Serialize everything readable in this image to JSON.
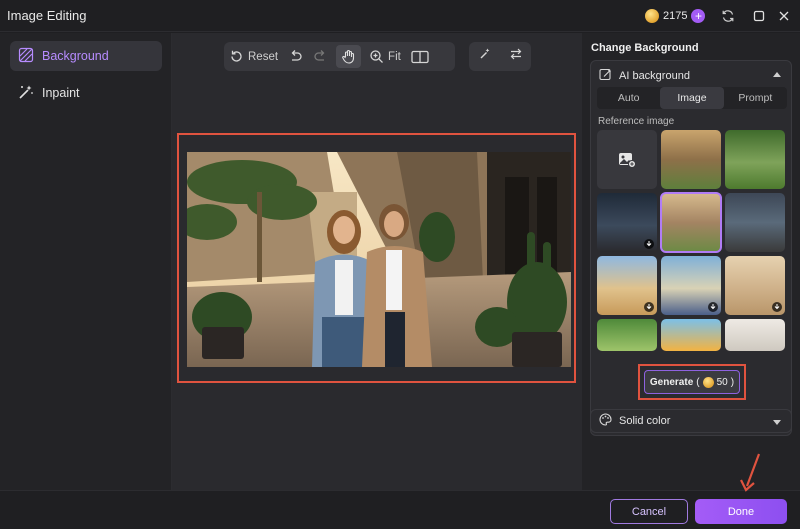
{
  "window": {
    "title": "Image Editing",
    "credits": "2175"
  },
  "sidebar": {
    "items": [
      {
        "label": "Background",
        "active": true
      },
      {
        "label": "Inpaint",
        "active": false
      }
    ]
  },
  "toolbar": {
    "reset_label": "Reset",
    "fit_label": "Fit"
  },
  "panel": {
    "title": "Change Background",
    "ai_section": "AI background",
    "tabs": [
      "Auto",
      "Image",
      "Prompt"
    ],
    "active_tab": "Image",
    "reference_label": "Reference image",
    "generate_label": "Generate",
    "generate_cost": "50",
    "solid_section": "Solid color"
  },
  "footer": {
    "cancel_label": "Cancel",
    "done_label": "Done"
  },
  "colors": {
    "accent": "#a45cf7",
    "highlight": "#e0533f"
  }
}
